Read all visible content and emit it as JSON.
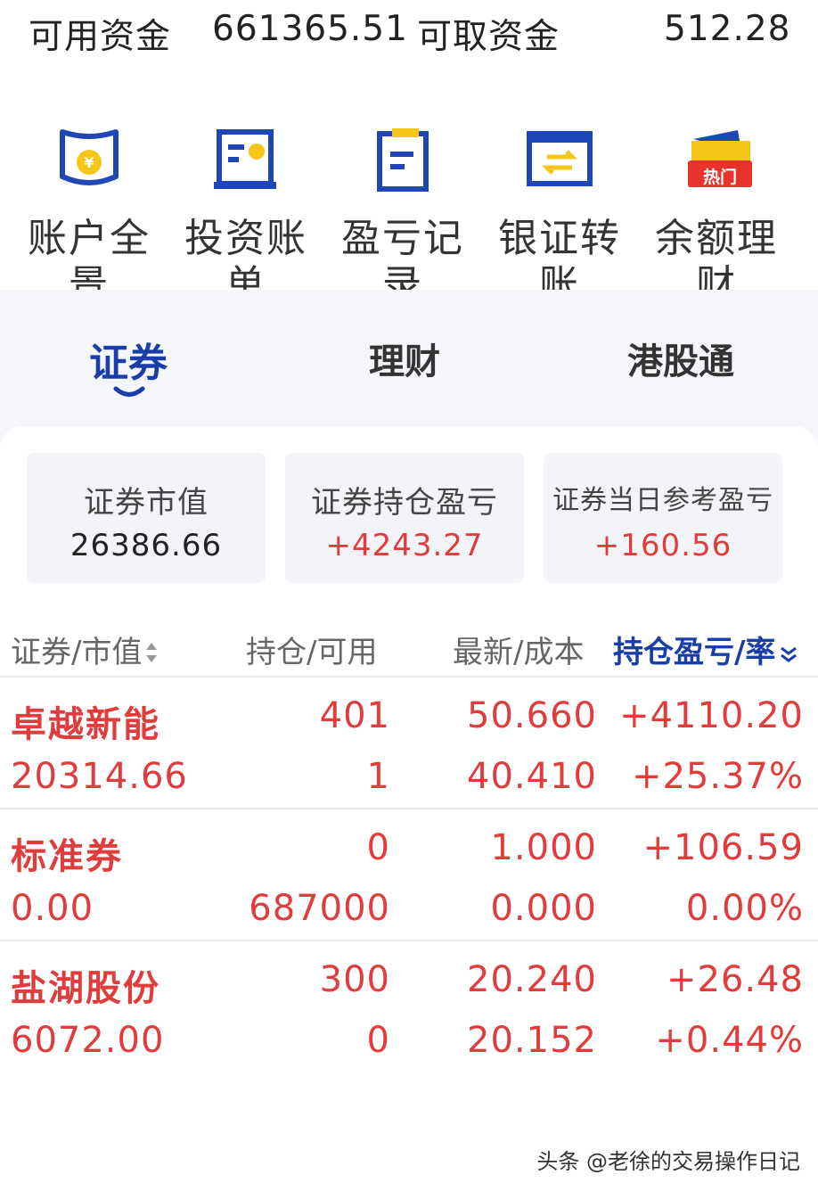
{
  "funds": {
    "available_label": "可用资金",
    "available_value": "661365.51",
    "withdrawable_label": "可取资金",
    "withdrawable_value": "512.28"
  },
  "quick_menu": [
    {
      "label": "账户全景",
      "icon": "account-overview-icon"
    },
    {
      "label": "投资账单",
      "icon": "investment-bill-icon"
    },
    {
      "label": "盈亏记录",
      "icon": "profit-record-icon"
    },
    {
      "label": "银证转账",
      "icon": "bank-transfer-icon"
    },
    {
      "label": "余额理财",
      "icon": "balance-wealth-icon",
      "badge": "热门"
    }
  ],
  "tabs": [
    {
      "label": "证券",
      "active": true
    },
    {
      "label": "理财",
      "active": false
    },
    {
      "label": "港股通",
      "active": false
    }
  ],
  "summary": [
    {
      "title": "证券市值",
      "value": "26386.66"
    },
    {
      "title": "证券持仓盈亏",
      "value": "+4243.27"
    },
    {
      "title": "证券当日参考盈亏",
      "value": "+160.56"
    }
  ],
  "table": {
    "headers": [
      "证券/市值",
      "持仓/可用",
      "最新/成本",
      "持仓盈亏/率"
    ],
    "rows": [
      {
        "name": "卓越新能",
        "market_value": "20314.66",
        "holding": "401",
        "available": "1",
        "latest": "50.660",
        "cost": "40.410",
        "pnl": "+4110.20",
        "pnl_rate": "+25.37%"
      },
      {
        "name": "标准券",
        "market_value": "0.00",
        "holding": "0",
        "available": "687000",
        "latest": "1.000",
        "cost": "0.000",
        "pnl": "+106.59",
        "pnl_rate": "0.00%"
      },
      {
        "name": "盐湖股份",
        "market_value": "6072.00",
        "holding": "300",
        "available": "0",
        "latest": "20.240",
        "cost": "20.152",
        "pnl": "+26.48",
        "pnl_rate": "+0.44%"
      }
    ]
  },
  "watermark": "头条 @老徐的交易操作日记",
  "colors": {
    "accent": "#1a3ea8",
    "profit": "#e03c3c",
    "icon_blue": "#1f47b8",
    "icon_yellow": "#f5c518",
    "hot_badge": "#e8322e"
  }
}
